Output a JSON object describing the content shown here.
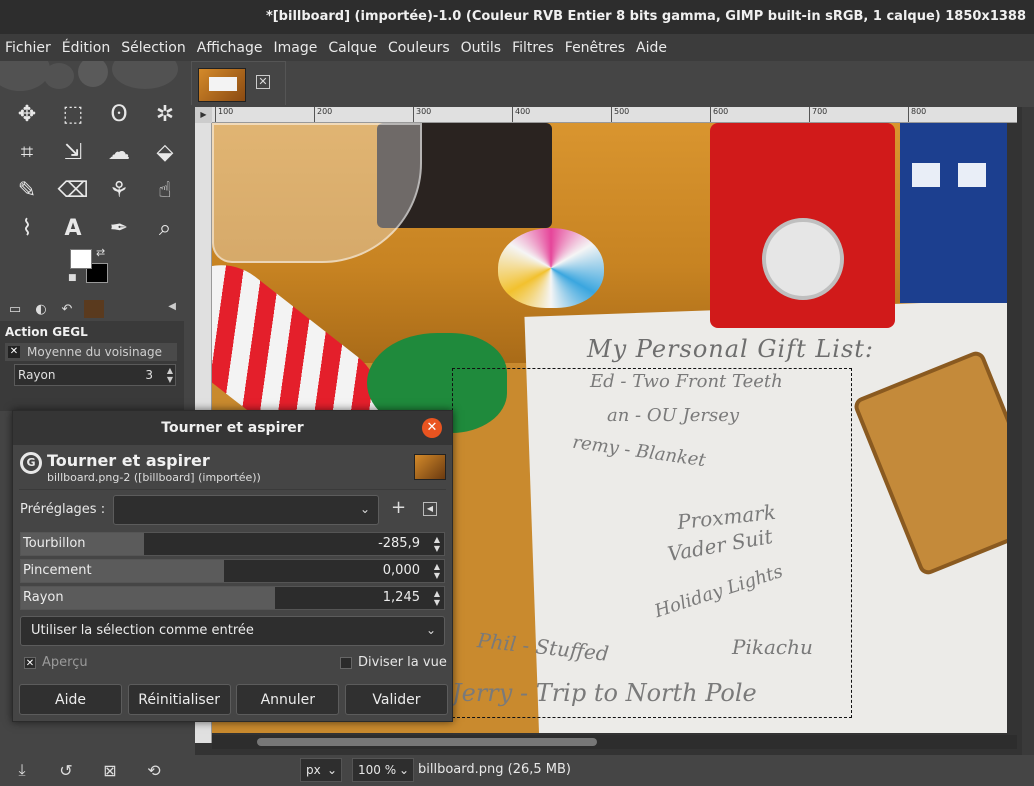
{
  "window": {
    "title": "*[billboard] (importée)-1.0 (Couleur RVB Entier 8 bits gamma, GIMP built-in sRGB, 1 calque) 1850x1388"
  },
  "menu": [
    "Fichier",
    "Édition",
    "Sélection",
    "Affichage",
    "Image",
    "Calque",
    "Couleurs",
    "Outils",
    "Filtres",
    "Fenêtres",
    "Aide"
  ],
  "tools": [
    "move-icon",
    "rect-select-icon",
    "lasso-icon",
    "fuzzy-select-icon",
    "crop-icon",
    "unified-transform-icon",
    "warp-icon",
    "bucket-fill-icon",
    "paintbrush-icon",
    "eraser-icon",
    "clone-icon",
    "smudge-icon",
    "paths-icon",
    "text-icon",
    "color-picker-icon",
    "zoom-icon"
  ],
  "dock": {
    "title": "Action GEGL",
    "filter": "Moyenne du voisinage",
    "rayon_label": "Rayon",
    "rayon_value": "3"
  },
  "ruler": [
    "100",
    "200",
    "300",
    "400",
    "500",
    "600",
    "700",
    "800"
  ],
  "dialog": {
    "window_title": "Tourner et aspirer",
    "name": "Tourner et aspirer",
    "subtitle": "billboard.png-2 ([billboard] (importée))",
    "presets_label": "Préréglages :",
    "sliders": [
      {
        "label": "Tourbillon",
        "value": "-285,9",
        "fill": 0.29
      },
      {
        "label": "Pincement",
        "value": "0,000",
        "fill": 0.48
      },
      {
        "label": "Rayon",
        "value": "1,245",
        "fill": 0.6
      }
    ],
    "input_mode": "Utiliser la sélection comme entrée",
    "preview_label": "Aperçu",
    "preview_checked": true,
    "split_label": "Diviser la vue",
    "split_checked": false,
    "buttons": [
      "Aide",
      "Réinitialiser",
      "Annuler",
      "Valider"
    ]
  },
  "canvas": {
    "gift_title": "My Personal Gift List:",
    "gift_lines": [
      "Ed - Two Front Teeth",
      "an - OU Jersey",
      "remy - Blanket",
      "Proxmark",
      "Vader Suit",
      "Holiday Lights",
      "Pikachu",
      "Phil - Stuffed",
      "Jerry - Trip to North Pole"
    ]
  },
  "status": {
    "unit": "px",
    "zoom": "100 %",
    "file": "billboard.png (26,5 MB)"
  }
}
